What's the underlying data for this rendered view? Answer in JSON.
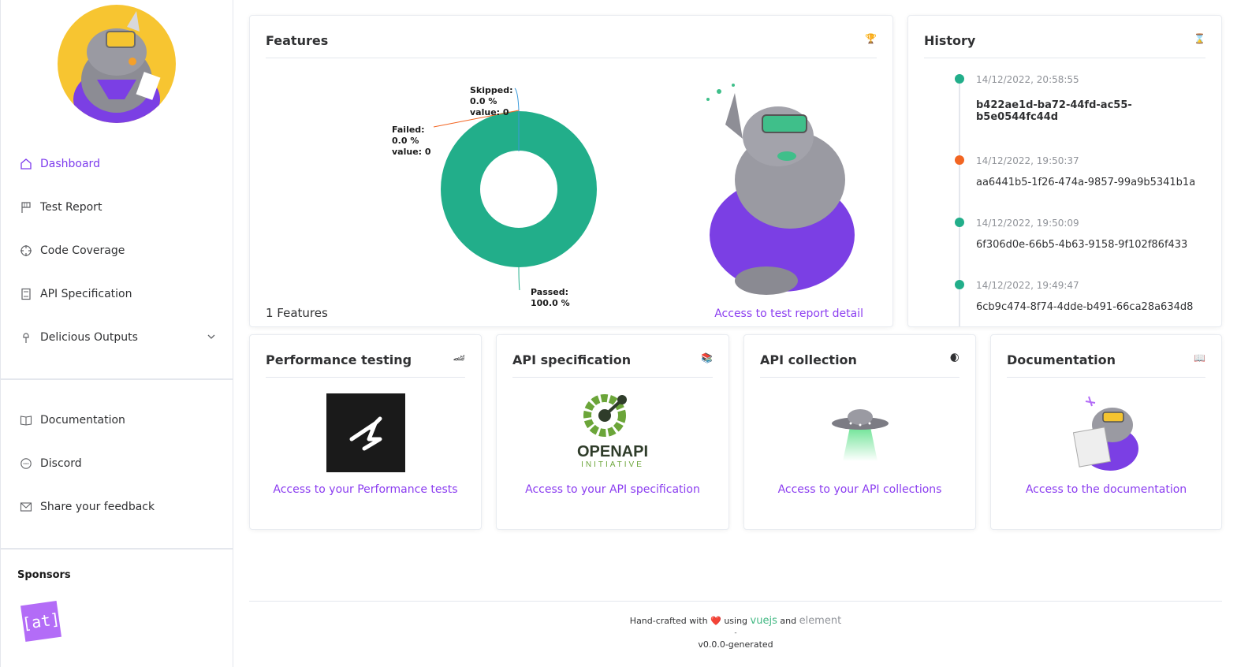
{
  "sidebar": {
    "nav": [
      {
        "label": "Dashboard",
        "icon": "home-icon",
        "active": true
      },
      {
        "label": "Test Report",
        "icon": "flag-icon"
      },
      {
        "label": "Code Coverage",
        "icon": "crosshair-icon"
      },
      {
        "label": "API Specification",
        "icon": "notebook-icon"
      },
      {
        "label": "Delicious Outputs",
        "icon": "ice-cream-icon"
      }
    ],
    "secondary": [
      {
        "label": "Documentation",
        "icon": "book-icon"
      },
      {
        "label": "Discord",
        "icon": "chat-icon"
      },
      {
        "label": "Share your feedback",
        "icon": "mail-icon"
      }
    ],
    "sponsors_title": "Sponsors",
    "sponsor_logo_text": "[at]"
  },
  "features": {
    "title": "Features",
    "icon": "🏆",
    "count_label": "1 Features",
    "link": "Access to test report detail"
  },
  "chart_data": {
    "type": "pie",
    "donut": true,
    "slices": [
      {
        "name": "Passed",
        "percent": "100.0 %",
        "value": 1,
        "color": "#22ae8a"
      },
      {
        "name": "Failed",
        "percent": "0.0 %",
        "value": 0,
        "color": "#f26522"
      },
      {
        "name": "Skipped",
        "percent": "0.0 %",
        "value": 0,
        "color": "#3a9bdc"
      }
    ],
    "labels": {
      "skipped": [
        "Skipped:",
        "0.0 %",
        "value: 0"
      ],
      "failed": [
        "Failed:",
        "0.0 %",
        "value: 0"
      ],
      "passed": [
        "Passed:",
        "100.0 %"
      ]
    }
  },
  "history": {
    "title": "History",
    "icon": "⌛",
    "items": [
      {
        "time": "14/12/2022, 20:58:55",
        "id": "b422ae1d-ba72-44fd-ac55-b5e0544fc44d",
        "color": "#22ae8a",
        "bold": true
      },
      {
        "time": "14/12/2022, 19:50:37",
        "id": "aa6441b5-1f26-474a-9857-99a9b5341b1a",
        "color": "#f26522"
      },
      {
        "time": "14/12/2022, 19:50:09",
        "id": "6f306d0e-66b5-4b63-9158-9f102f86f433",
        "color": "#22ae8a"
      },
      {
        "time": "14/12/2022, 19:49:47",
        "id": "6cb9c474-8f74-4dde-b491-66ca28a634d8",
        "color": "#22ae8a"
      }
    ]
  },
  "cards": [
    {
      "title": "Performance testing",
      "icon": "🏎",
      "link": "Access to your Performance tests"
    },
    {
      "title": "API specification",
      "icon": "📚",
      "link": "Access to your API specification",
      "logo_text": "OPENAPI",
      "logo_sub": "INITIATIVE"
    },
    {
      "title": "API collection",
      "icon": "🌒",
      "link": "Access to your API collections"
    },
    {
      "title": "Documentation",
      "icon": "📖",
      "link": "Access to the documentation"
    }
  ],
  "footer": {
    "prefix": "Hand-crafted with",
    "heart": "❤️",
    "using": "using",
    "vuejs": "vuejs",
    "and": "and",
    "element": "element",
    "dash": "-",
    "version": "v0.0.0-generated"
  }
}
